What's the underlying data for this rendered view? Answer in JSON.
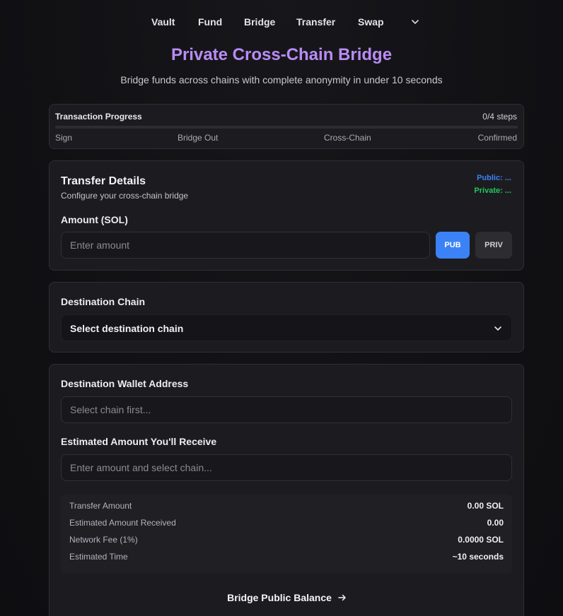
{
  "nav": {
    "items": [
      "Vault",
      "Fund",
      "Bridge",
      "Transfer",
      "Swap"
    ],
    "more_icon": "chevron-down-icon"
  },
  "header": {
    "title": "Private Cross-Chain Bridge",
    "subtitle": "Bridge funds across chains with complete anonymity in under 10 seconds"
  },
  "progress": {
    "label": "Transaction Progress",
    "count": "0/4 steps",
    "completed_fraction": 0,
    "steps": [
      "Sign",
      "Bridge Out",
      "Cross-Chain",
      "Confirmed"
    ]
  },
  "transfer": {
    "title": "Transfer Details",
    "subtitle": "Configure your cross-chain bridge",
    "public_balance": "Public: ...",
    "private_balance": "Private: ...",
    "amount_label": "Amount (SOL)",
    "amount_placeholder": "Enter amount",
    "pub_label": "PUB",
    "priv_label": "PRIV"
  },
  "chain": {
    "label": "Destination Chain",
    "selected": "Select destination chain"
  },
  "wallet": {
    "label": "Destination Wallet Address",
    "placeholder": "Select chain first...",
    "estimate_label": "Estimated Amount You'll Receive",
    "estimate_placeholder": "Enter amount and select chain..."
  },
  "summary": {
    "rows": [
      {
        "label": "Transfer Amount",
        "value": "0.00 SOL"
      },
      {
        "label": "Estimated Amount Received",
        "value": "0.00"
      },
      {
        "label": "Network Fee (1%)",
        "value": "0.0000 SOL"
      },
      {
        "label": "Estimated Time",
        "value": "~10 seconds"
      }
    ]
  },
  "action": {
    "label": "Bridge Public Balance",
    "icon": "arrow-right-icon"
  },
  "colors": {
    "accent_title": "#b98cf5",
    "public": "#3b82f6",
    "private": "#22c55e",
    "pub_button": "#3b82f6"
  }
}
